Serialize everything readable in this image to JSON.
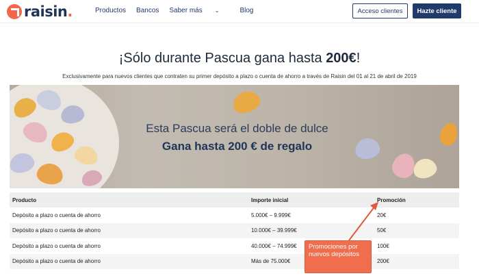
{
  "nav": {
    "logo": "raisin",
    "links": [
      "Productos",
      "Bancos",
      "Saber más",
      "Blog"
    ],
    "login_label": "Acceso clientes",
    "signup_label": "Hazte cliente"
  },
  "hero": {
    "title_prefix": "¡Sólo durante Pascua gana hasta ",
    "title_amount": "200€",
    "title_suffix": "!",
    "subtitle": "Exclusivamente para nuevos clientes que contraten su primer depósito a plazo o cuenta de ahorro a través de Raisin del 01 al 21 de abril de 2019"
  },
  "banner": {
    "line1": "Esta Pascua será el doble de dulce",
    "line2": "Gana hasta 200 € de regalo"
  },
  "table": {
    "headers": [
      "Producto",
      "Importe inicial",
      "Promoción"
    ],
    "rows": [
      [
        "Depósito a plazo o cuenta de ahorro",
        "5.000€ – 9.999€",
        "20€"
      ],
      [
        "Depósito a plazo o cuenta de ahorro",
        "10.000€ – 39.999€",
        "50€"
      ],
      [
        "Depósito a plazo o cuenta de ahorro",
        "40.000€ – 74.999€",
        "100€"
      ],
      [
        "Depósito a plazo o cuenta de ahorro",
        "Más de 75.000€",
        "200€"
      ]
    ]
  },
  "annotation": {
    "text": "Promociones por nuevos depósitos"
  },
  "colors": {
    "brand_navy": "#1f3a6b",
    "brand_orange": "#f2664b",
    "annotation": "#f06d4e"
  }
}
